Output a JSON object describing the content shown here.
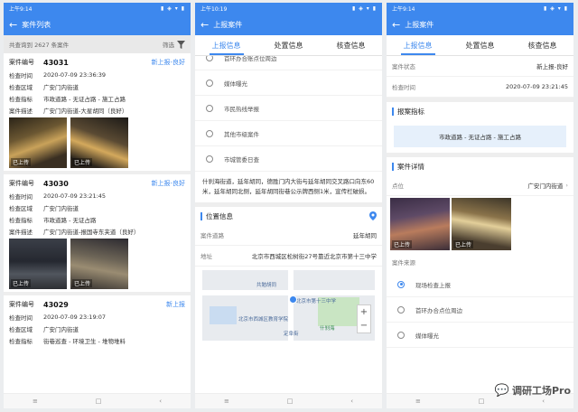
{
  "status_bar": {
    "time_1": "上午9:14",
    "time_2": "上午10:19",
    "time_3": "上午9:14",
    "icons": "▮ ◈ ▾ ▮"
  },
  "panel1": {
    "title": "案件列表",
    "filter_count": "共查询到 2627 条案件",
    "filter_label": "筛选",
    "cases": [
      {
        "no_label": "案件编号",
        "no": "43031",
        "status": "新上报-良好",
        "rows": [
          [
            "检查时间",
            "2020-07-09 23:36:39"
          ],
          [
            "检查区域",
            "广安门内街道"
          ],
          [
            "检查指标",
            "市政道路 - 无证占路 - 施工占路"
          ],
          [
            "案件描述",
            "广安门内街道-大星胡同（良好）"
          ]
        ],
        "photo_label": "已上传"
      },
      {
        "no_label": "案件编号",
        "no": "43030",
        "status": "新上报-良好",
        "rows": [
          [
            "检查时间",
            "2020-07-09 23:21:45"
          ],
          [
            "检查区域",
            "广安门内街道"
          ],
          [
            "检查指标",
            "市政道路 - 无证占路"
          ],
          [
            "案件描述",
            "广安门内街道-报国寺东夹道（良好）"
          ]
        ],
        "photo_label": "已上传"
      },
      {
        "no_label": "案件编号",
        "no": "43029",
        "status": "新上报",
        "rows": [
          [
            "检查时间",
            "2020-07-09 23:19:07"
          ],
          [
            "检查区域",
            "广安门内街道"
          ],
          [
            "检查指标",
            "街巷巡查 - 环境卫生 - 堆物堆料"
          ]
        ],
        "photo_label": ""
      }
    ]
  },
  "panel2": {
    "title": "上报案件",
    "tabs": [
      "上报信息",
      "处置信息",
      "核查信息"
    ],
    "radio_options": [
      "首环办合账点位周边",
      "媒体曝光",
      "市民热线举报",
      "其他市级案件",
      "市城管委日查"
    ],
    "description": "什刹海街道，延年胡同，德胜门内大街与延年胡同交叉路口向东60米，延年胡同北侧，延年胡同街巷公示牌西侧1米，宣传栏破损。",
    "location_title": "位置信息",
    "street_label": "案件道路",
    "street_value": "延年胡同",
    "address_label": "地址",
    "address_value": "北京市西城区松树街27号靠近北京市第十三中学",
    "map_labels": [
      "共勉胡同",
      "北京市第十三中学",
      "北京市西城区教育学院",
      "什刹海",
      "定阜街"
    ],
    "zoom_in": "+",
    "zoom_out": "−"
  },
  "panel3": {
    "title": "上报案件",
    "tabs": [
      "上报信息",
      "处置信息",
      "核查信息"
    ],
    "case_status_label": "案件状态",
    "case_status_value": "新上报-良好",
    "check_time_label": "检查时间",
    "check_time_value": "2020-07-09 23:21:45",
    "indicator_title": "报案指标",
    "indicator_value": "市政道路 - 无证占路 - 施工占路",
    "detail_title": "案件详情",
    "point_label": "点位",
    "point_value": "广安门内街道",
    "photo_label": "已上传",
    "source_label": "案件来源",
    "source_options": [
      "现场检查上报",
      "首环办合点位周边",
      "媒体曝光"
    ]
  },
  "nav": {
    "menu": "≡",
    "home": "□",
    "back": "‹"
  },
  "watermark": {
    "text": "调研工场Pro",
    "icon": "speech-bubble-icon"
  },
  "colors": {
    "primary": "#3d88ee"
  }
}
